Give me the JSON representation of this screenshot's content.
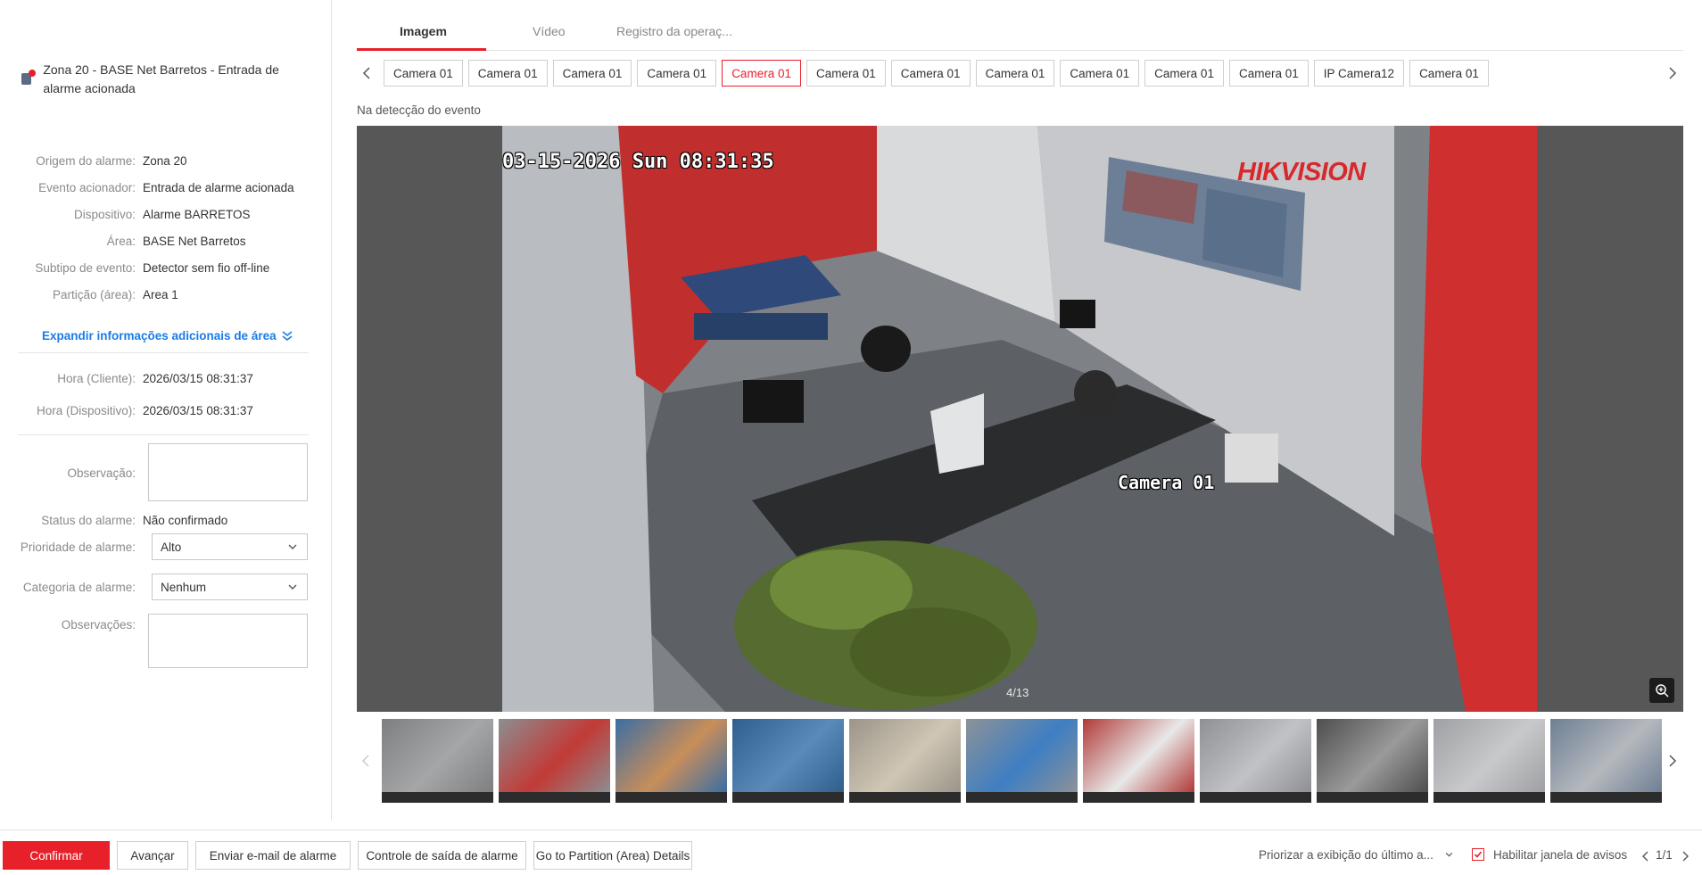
{
  "alarm_header": {
    "title": "Zona 20 - BASE Net Barretos - Entrada de alarme acionada"
  },
  "details": [
    {
      "label": "Origem do alarme:",
      "value": "Zona 20"
    },
    {
      "label": "Evento acionador:",
      "value": "Entrada de alarme acionada"
    },
    {
      "label": "Dispositivo:",
      "value": "Alarme BARRETOS"
    },
    {
      "label": "Área:",
      "value": "BASE Net Barretos"
    },
    {
      "label": "Subtipo de evento:",
      "value": "Detector sem fio off-line"
    },
    {
      "label": "Partição (área):",
      "value": "Area 1"
    }
  ],
  "expand_label": "Expandir informações adicionais de área",
  "times": [
    {
      "label": "Hora (Cliente):",
      "value": "2026/03/15 08:31:37"
    },
    {
      "label": "Hora (Dispositivo):",
      "value": "2026/03/15 08:31:37"
    }
  ],
  "form": {
    "observation_label": "Observação:",
    "observation_value": "",
    "status_label": "Status do alarme:",
    "status_value": "Não confirmado",
    "priority_label": "Prioridade de alarme:",
    "priority_value": "Alto",
    "category_label": "Categoria de alarme:",
    "category_value": "Nenhum",
    "remarks_label": "Observações:",
    "remarks_value": ""
  },
  "tabs": [
    {
      "label": "Imagem",
      "active": true
    },
    {
      "label": "Vídeo",
      "active": false
    },
    {
      "label": "Registro da operaç...",
      "active": false
    }
  ],
  "cameras": [
    {
      "label": "Camera 01",
      "active": false
    },
    {
      "label": "Camera 01",
      "active": false
    },
    {
      "label": "Camera 01",
      "active": false
    },
    {
      "label": "Camera 01",
      "active": false
    },
    {
      "label": "Camera 01",
      "active": true
    },
    {
      "label": "Camera 01",
      "active": false
    },
    {
      "label": "Camera 01",
      "active": false
    },
    {
      "label": "Camera 01",
      "active": false
    },
    {
      "label": "Camera 01",
      "active": false
    },
    {
      "label": "Camera 01",
      "active": false
    },
    {
      "label": "Camera 01",
      "active": false
    },
    {
      "label": "IP Camera12",
      "active": false
    },
    {
      "label": "Camera 01",
      "active": false
    }
  ],
  "event_label": "Na detecção do evento",
  "viewer": {
    "osd_timestamp": "03-15-2026 Sun 08:31:35",
    "osd_camera": "Camera 01",
    "brand": "HIKVISION",
    "brand_color": "#d8282c",
    "counter": "4/13",
    "zoom_icon": "zoom-in-icon"
  },
  "thumbnails": [
    {
      "tone": "#7d7f81",
      "accent": "#a5a6a8",
      "active": false
    },
    {
      "tone": "#8c8e91",
      "accent": "#c23a36",
      "active": true
    },
    {
      "tone": "#3b6ea3",
      "accent": "#c88e5a",
      "active": false
    },
    {
      "tone": "#2f5f8c",
      "accent": "#5a8ab8",
      "active": false
    },
    {
      "tone": "#9b9488",
      "accent": "#cfc6b4",
      "active": false
    },
    {
      "tone": "#8d9298",
      "accent": "#3e7ec2",
      "active": false
    },
    {
      "tone": "#b13a38",
      "accent": "#e8e8e8",
      "active": false
    },
    {
      "tone": "#8e9094",
      "accent": "#c0c2c5",
      "active": false
    },
    {
      "tone": "#4e4e4e",
      "accent": "#9a9a9a",
      "active": false
    },
    {
      "tone": "#9ea0a3",
      "accent": "#c8c9cb",
      "active": false
    },
    {
      "tone": "#6e7f94",
      "accent": "#b5b9be",
      "active": false
    }
  ],
  "footer": {
    "confirm": "Confirmar",
    "advance": "Avançar",
    "email": "Enviar e-mail de alarme",
    "output": "Controle de saída de alarme",
    "partition": "Go to Partition (Area) Details",
    "priority_display": "Priorizar a exibição do último a...",
    "enable_popup": "Habilitar janela de avisos",
    "enable_popup_checked": true,
    "pagination": "1/1"
  },
  "colors": {
    "accent": "#e8202a",
    "link": "#1a7ce6"
  }
}
